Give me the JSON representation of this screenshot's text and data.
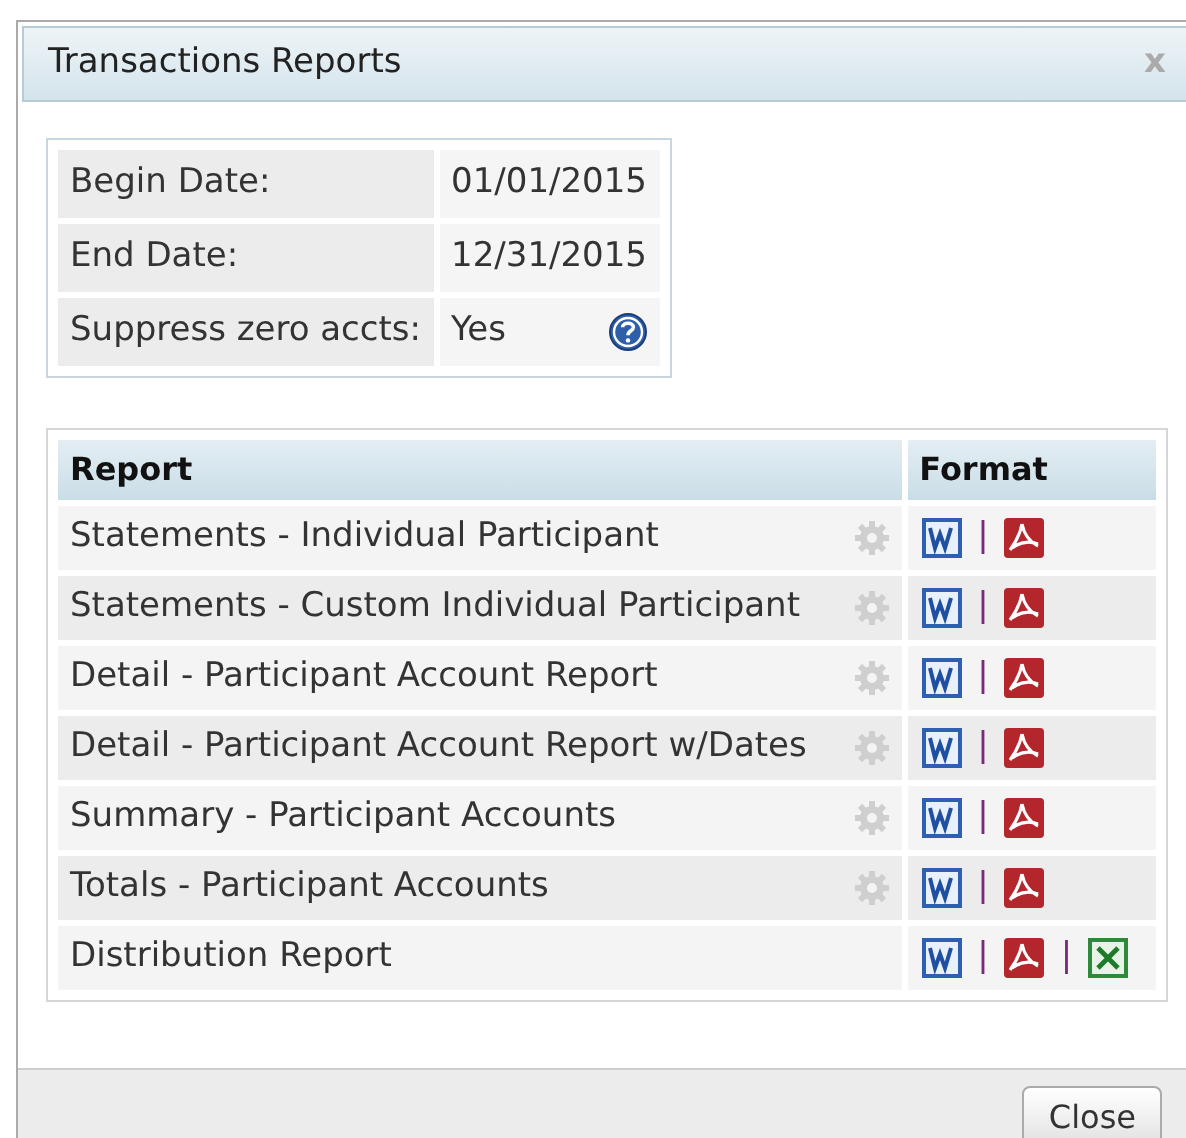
{
  "dialog": {
    "title": "Transactions Reports",
    "close": "x"
  },
  "settings": [
    {
      "label": "Begin Date:",
      "value": "01/01/2015",
      "help": false
    },
    {
      "label": "End Date:",
      "value": "12/31/2015",
      "help": false
    },
    {
      "label": "Suppress zero accts:",
      "value": "Yes",
      "help": true
    }
  ],
  "table": {
    "columns": [
      "Report",
      "Format"
    ],
    "rows": [
      {
        "report": "Statements - Individual Participant",
        "options": true,
        "formats": [
          {
            "kind": "word"
          },
          {
            "kind": "separator",
            "text": "|"
          },
          {
            "kind": "pdf"
          }
        ]
      },
      {
        "report": "Statements - Custom Individual Participant",
        "options": true,
        "formats": [
          {
            "kind": "word"
          },
          {
            "kind": "separator",
            "text": "|"
          },
          {
            "kind": "pdf"
          }
        ]
      },
      {
        "report": "Detail - Participant Account Report",
        "options": true,
        "formats": [
          {
            "kind": "word"
          },
          {
            "kind": "separator",
            "text": "|"
          },
          {
            "kind": "pdf"
          }
        ]
      },
      {
        "report": "Detail - Participant Account Report w/Dates",
        "options": true,
        "formats": [
          {
            "kind": "word"
          },
          {
            "kind": "separator",
            "text": "|"
          },
          {
            "kind": "pdf"
          }
        ]
      },
      {
        "report": "Summary - Participant Accounts",
        "options": true,
        "formats": [
          {
            "kind": "word"
          },
          {
            "kind": "separator",
            "text": "|"
          },
          {
            "kind": "pdf"
          }
        ]
      },
      {
        "report": "Totals - Participant Accounts",
        "options": true,
        "formats": [
          {
            "kind": "word"
          },
          {
            "kind": "separator",
            "text": "|"
          },
          {
            "kind": "pdf"
          }
        ]
      },
      {
        "report": "Distribution Report",
        "options": false,
        "formats": [
          {
            "kind": "word"
          },
          {
            "kind": "separator",
            "text": "|"
          },
          {
            "kind": "pdf"
          },
          {
            "kind": "separator",
            "text": "|"
          },
          {
            "kind": "excel"
          }
        ]
      }
    ]
  },
  "buttons": [
    "Close"
  ]
}
